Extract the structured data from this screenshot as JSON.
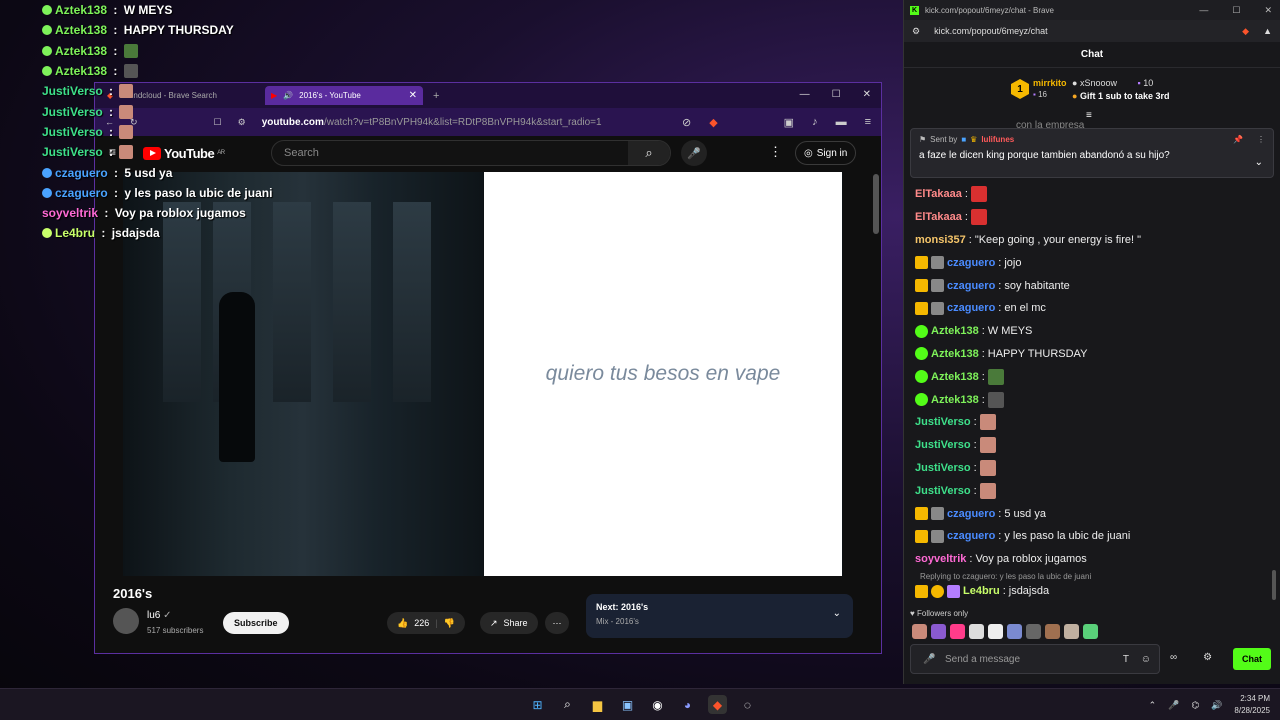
{
  "overlay": {
    "lines": [
      {
        "user": "Aztek138",
        "sep": " : ",
        "text": "W MEYS",
        "color": "#7ef25a"
      },
      {
        "user": "Aztek138",
        "sep": " : ",
        "text": "HAPPY THURSDAY",
        "color": "#7ef25a"
      },
      {
        "user": "Aztek138",
        "sep": " : ",
        "text": "",
        "color": "#7ef25a"
      },
      {
        "user": "Aztek138",
        "sep": " : ",
        "text": "",
        "color": "#7ef25a"
      },
      {
        "user": "JustiVerso",
        "sep": " : ",
        "text": "",
        "color": "#3ee08a"
      },
      {
        "user": "JustiVerso",
        "sep": " : ",
        "text": "",
        "color": "#3ee08a"
      },
      {
        "user": "JustiVerso",
        "sep": " : ",
        "text": "",
        "color": "#3ee08a"
      },
      {
        "user": "JustiVerso",
        "sep": " : ",
        "text": "",
        "color": "#3ee08a"
      },
      {
        "user": "czaguero",
        "sep": " : ",
        "text": "5 usd ya",
        "color": "#4aa3ff"
      },
      {
        "user": "czaguero",
        "sep": " : ",
        "text": "y les paso la ubic de juani",
        "color": "#4aa3ff"
      },
      {
        "user": "soyveltrik",
        "sep": " : ",
        "text": "Voy pa roblox jugamos",
        "color": "#ff6ad5"
      },
      {
        "user": "Le4bru",
        "sep": " : ",
        "text": "jsdajsda",
        "color": "#c8ff6a"
      }
    ]
  },
  "yt": {
    "tabs": [
      {
        "label": "Soundcloud - Brave Search"
      },
      {
        "label": "2016's - YouTube"
      }
    ],
    "new_tab": "+",
    "url_host": "youtube.com",
    "url_rest": "/watch?v=tP8BnVPH94k&list=RDtP8BnVPH94k&start_radio=1",
    "logo": "YouTube",
    "logo_region": "AR",
    "search_placeholder": "Search",
    "sign_in": "Sign in",
    "video_text": "quiero tus besos en vape",
    "title": "2016's",
    "channel": "lu6",
    "subscribers": "517 subscribers",
    "subscribe": "Subscribe",
    "likes": "226",
    "share": "Share",
    "next_label": "Next: 2016's",
    "next_sub": "Mix - 2016's"
  },
  "kick": {
    "window_title": "kick.com/popout/6meyz/chat - Brave",
    "url": "kick.com/popout/6meyz/chat",
    "header": "Chat",
    "top_gifter": {
      "rank": "1",
      "name": "mirrkito",
      "count": "16"
    },
    "second": {
      "name": "xSnooow",
      "count": "10"
    },
    "gift_cta": "Gift 1 sub to take 3rd",
    "partial_line": "con la empresa",
    "pinned_by_label": "Sent by",
    "pinned_by_user": "lulifunes",
    "pinned_text": "a faze le dicen king porque tambien abandonó a su hijo?",
    "messages": [
      {
        "user": "ElTakaaa",
        "text": "",
        "color": "#ff8a8a"
      },
      {
        "user": "ElTakaaa",
        "text": "",
        "color": "#ff8a8a"
      },
      {
        "user": "monsi357",
        "text": "\"Keep going , your energy is fire! \"",
        "color": "#f5c56a"
      },
      {
        "user": "czaguero",
        "text": "jojo",
        "color": "#4a8bff"
      },
      {
        "user": "czaguero",
        "text": "soy habitante",
        "color": "#4a8bff"
      },
      {
        "user": "czaguero",
        "text": "en el mc",
        "color": "#4a8bff"
      },
      {
        "user": "Aztek138",
        "text": "W MEYS",
        "color": "#7ef25a"
      },
      {
        "user": "Aztek138",
        "text": "HAPPY THURSDAY",
        "color": "#7ef25a"
      },
      {
        "user": "Aztek138",
        "text": "",
        "color": "#7ef25a"
      },
      {
        "user": "Aztek138",
        "text": "",
        "color": "#7ef25a"
      },
      {
        "user": "JustiVerso",
        "text": "",
        "color": "#3ee08a"
      },
      {
        "user": "JustiVerso",
        "text": "",
        "color": "#3ee08a"
      },
      {
        "user": "JustiVerso",
        "text": "",
        "color": "#3ee08a"
      },
      {
        "user": "JustiVerso",
        "text": "",
        "color": "#3ee08a"
      },
      {
        "user": "czaguero",
        "text": "5 usd ya",
        "color": "#4a8bff"
      },
      {
        "user": "czaguero",
        "text": "y les paso la ubic de juani",
        "color": "#4a8bff"
      },
      {
        "user": "soyveltrik",
        "text": "Voy pa roblox jugamos",
        "color": "#ff6ad5"
      }
    ],
    "reply_hint": "Replying to czaguero: y les paso la ubic de juani",
    "last_msg": {
      "user": "Le4bru",
      "text": "jsdajsda",
      "color": "#c8ff6a"
    },
    "followers_only": "Followers only",
    "send_placeholder": "Send a message",
    "chat_button": "Chat",
    "accent": "#53fc18"
  },
  "taskbar": {
    "time": "2:34 PM",
    "date": "8/28/2025"
  }
}
